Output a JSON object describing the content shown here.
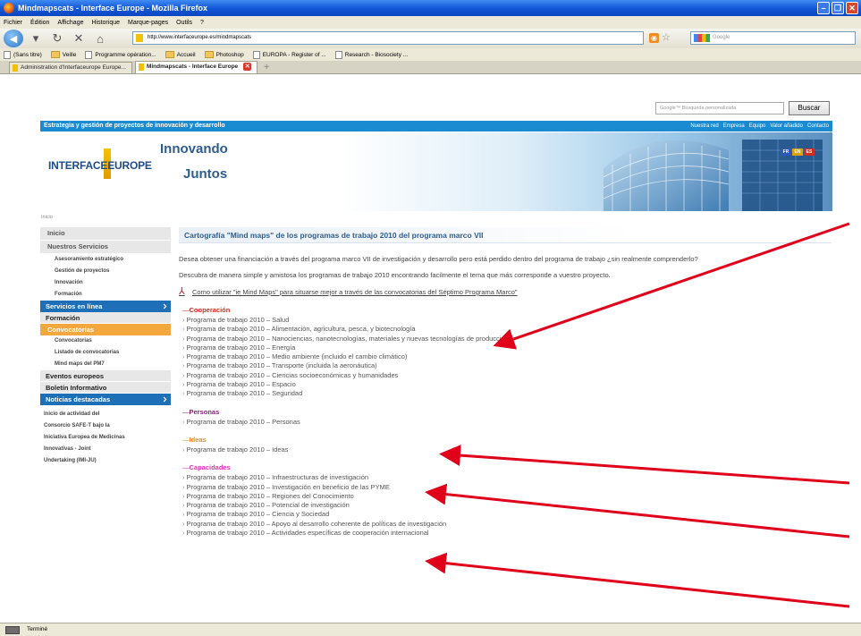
{
  "window": {
    "title": "Mindmapscats - Interface Europe - Mozilla Firefox"
  },
  "menu": [
    "Fichier",
    "Édition",
    "Affichage",
    "Historique",
    "Marque-pages",
    "Outils",
    "?"
  ],
  "nav": {
    "url": "http://www.interfaceurope.es/mindmapscats",
    "search_placeholder": "Google"
  },
  "bookmarks": [
    {
      "label": "(Sans titre)",
      "type": "doc"
    },
    {
      "label": "Veille",
      "type": "folder"
    },
    {
      "label": "Programme opération...",
      "type": "doc"
    },
    {
      "label": "Accueil",
      "type": "folder"
    },
    {
      "label": "Photoshop",
      "type": "folder"
    },
    {
      "label": "EUROPA - Register of ...",
      "type": "doc"
    },
    {
      "label": "Research - Biosociety ...",
      "type": "doc"
    }
  ],
  "tabs": [
    {
      "label": "Administration d'Interfaceurope Europe..."
    },
    {
      "label": "Mindmapscats - Interface Europe"
    }
  ],
  "site": {
    "search_placeholder": "Google™ Búsqueda personalizada",
    "search_button": "Buscar",
    "tagline": "Estrategia y gestión de proyectos de innovación y desarrollo",
    "topnav": [
      "Nuestra red",
      "Empresa",
      "Equipo",
      "Valor añadido",
      "Contacto"
    ],
    "logo": "INTERFACEEUROPE",
    "slogan_line1": "Innovando",
    "slogan_line2": "Juntos",
    "languages": [
      {
        "code": "FR",
        "color": "#2d56b8"
      },
      {
        "code": "EN",
        "color": "#e0a100"
      },
      {
        "code": "ES",
        "color": "#d52b1e"
      }
    ],
    "breadcrumb": "Inicio"
  },
  "sidebar": {
    "inicio": "Inicio",
    "servicios": "Nuestros Servicios",
    "servicios_items": [
      "Asesoramiento estratégico",
      "Gestión de proyectos",
      "Innovación",
      "Formación"
    ],
    "en_linea": "Servicios en línea",
    "formacion": "Formación",
    "convocatorias": "Convocatorias",
    "conv_items": [
      "Convocatorias",
      "Listado de convocatorias",
      "Mind maps del PM7"
    ],
    "eventos": "Eventos europeos",
    "boletin": "Boletín Informativo",
    "noticias": "Noticias destacadas",
    "news_lines": [
      "Inicio de actividad del",
      "Consorcio SAFE-T bajo la",
      "Iniciativa Europea de Medicinas",
      "Innovativas - Joint",
      "Undertaking (IMI-JU)"
    ]
  },
  "main": {
    "title": "Cartografía \"Mind maps\" de los programas de trabajo 2010 del programa marco VII",
    "intro1": "Desea obtener una financiación a través del programa marco VII de investigación y desarrollo pero está perdido dentro del programa de trabajo ¿sin realmente comprenderlo?",
    "intro2": "Descubra de manera simple y amistosa los programas de trabajo 2010 encontrando facilmente el tema que más corresponde a vuestro proyecto.",
    "pdf_link": "Como utilizar \"ie Mind Maps\" para situarse mejor a través de las convocatorias del Séptimo Programa Marco\"",
    "sections": [
      {
        "title": "Cooperación",
        "color": "#e0261b",
        "items": [
          "Programa de trabajo 2010 – Salud",
          "Programa de trabajo 2010 – Alimentación, agricultura, pesca, y biotecnología",
          "Programa de trabajo 2010 – Nanociencias, nanotecnologías, materiales y nuevas tecnologías de producción",
          "Programa de trabajo 2010 – Energía",
          "Programa de trabajo 2010 – Medio ambiente (incluido el cambio climático)",
          "Programa de trabajo 2010 – Transporte (incluida la aeronáutica)",
          "Programa de trabajo 2010 – Ciencias socioeconómicas y humanidades",
          "Programa de trabajo 2010 – Espacio",
          "Programa de trabajo 2010 – Seguridad"
        ]
      },
      {
        "title": "Personas",
        "color": "#8a1f7a",
        "items": [
          "Programa de trabajo 2010 – Personas"
        ]
      },
      {
        "title": "Ideas",
        "color": "#f08a1c",
        "items": [
          "Programa de trabajo 2010 – Ideas"
        ]
      },
      {
        "title": "Capacidades",
        "color": "#e62db4",
        "items": [
          "Programa de trabajo 2010 – Infraestructuras de investigación",
          "Programa de trabajo 2010 – Investigación en beneficio de las PYME",
          "Programa de trabajo 2010 – Regiones del Conocimiento",
          "Programa de trabajo 2010 – Potencial de investigación",
          "Programa de trabajo 2010 – Ciencia y Sociedad",
          "Programa de trabajo 2010 – Apoyo al desarrollo coherente de políticas de investigación",
          "Programa de trabajo 2010 – Actividades específicas de cooperación internacional"
        ]
      }
    ]
  },
  "status": {
    "text": "Terminé"
  },
  "colors": {
    "annotation": "#e0001a",
    "site_blue": "#1a8bd1"
  }
}
